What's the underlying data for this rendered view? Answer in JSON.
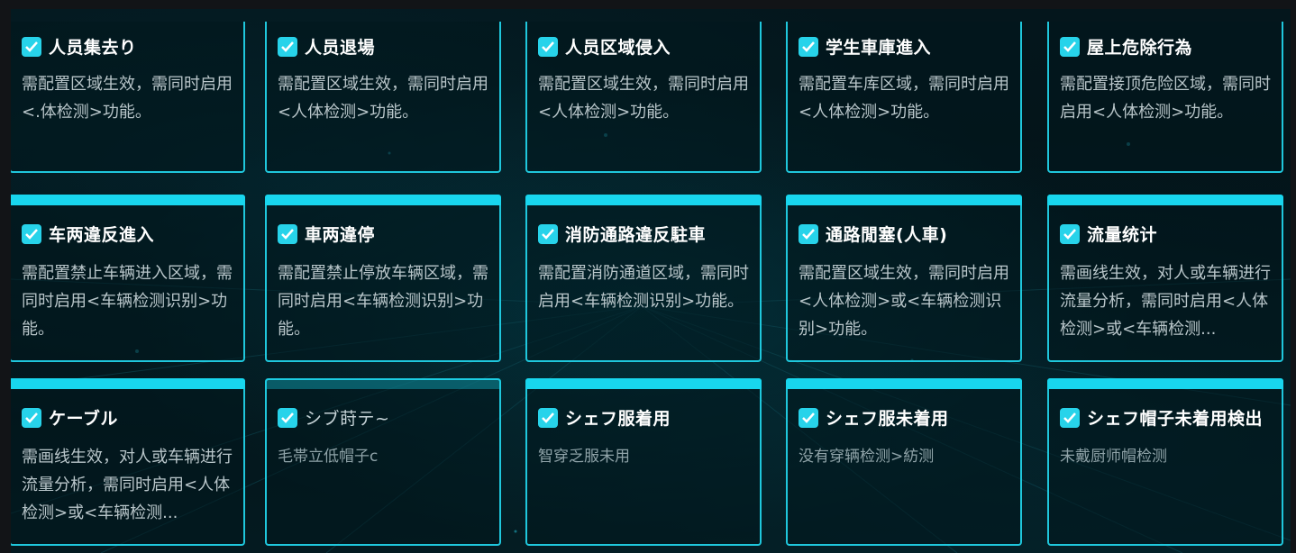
{
  "rows": [
    [
      {
        "title": "人员集去り",
        "desc": "需配置区域生效，需同时启用<.体检测>功能。"
      },
      {
        "title": "人员退場",
        "desc": "需配置区域生效，需同时启用<人体检测>功能。"
      },
      {
        "title": "人员区域侵入",
        "desc": "需配置区域生效，需同时启用<人体检测>功能。"
      },
      {
        "title": "学生車庫進入",
        "desc": "需配置车库区域，需同时启用<人体检测>功能。"
      },
      {
        "title": "屋上危除行為",
        "desc": "需配置接顶危险区域，需同时启用<人体检测>功能。"
      }
    ],
    [
      {
        "title": "车两違反進入",
        "desc": "需配置禁止车辆进入区域，需同时启用<车辆检测识别>功能。"
      },
      {
        "title": "車两違停",
        "desc": "需配置禁止停放车辆区域，需同时启用<车辆检测识别>功能。"
      },
      {
        "title": "消防通路違反駐車",
        "desc": "需配置消防通道区域，需同时启用<车辆检测识别>功能。"
      },
      {
        "title": "通路閒塞(人車)",
        "desc": "需配置区域生效，需同时启用<人体检测>或<车辆检测识别>功能。"
      },
      {
        "title": "流量统计",
        "desc": "需画线生效，对人或车辆进行流量分析，需同时启用<人体检测>或<车辆检测..."
      }
    ],
    [
      {
        "title": "ケーブル",
        "desc": "需画线生效，对人或车辆进行流量分析，需同时启用<人体检测>或<车辆检测..."
      },
      {
        "title": "シブ莳テ~",
        "desc": "毛帯立低帽子c"
      },
      {
        "title": "シェフ服着用",
        "desc": "智穿乏服未用"
      },
      {
        "title": "シェフ服未着用",
        "desc": "没有穿辆检测>紡测"
      },
      {
        "title": "シェフ帽子未着用検出",
        "desc": "未戴厨师帽检测"
      }
    ]
  ]
}
